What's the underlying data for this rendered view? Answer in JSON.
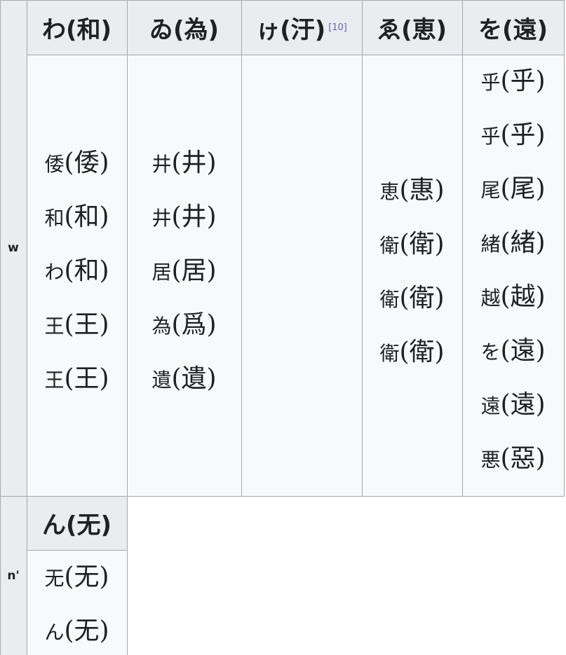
{
  "rows": [
    {
      "label": "w",
      "columns": [
        {
          "header": "わ(和)",
          "ref": "",
          "variants": [
            {
              "glyph": "倭",
              "text": "(倭)"
            },
            {
              "glyph": "和",
              "text": "(和)"
            },
            {
              "glyph": "わ",
              "text": "(和)"
            },
            {
              "glyph": "王",
              "text": "(王)"
            },
            {
              "glyph": "王",
              "text": "(王)"
            }
          ]
        },
        {
          "header": "ゐ(為)",
          "ref": "",
          "variants": [
            {
              "glyph": "井",
              "text": "(井)"
            },
            {
              "glyph": "井",
              "text": "(井)"
            },
            {
              "glyph": "居",
              "text": "(居)"
            },
            {
              "glyph": "為",
              "text": "(爲)"
            },
            {
              "glyph": "遺",
              "text": "(遺)"
            }
          ]
        },
        {
          "header": "ゖ(汙)",
          "ref": "[10]",
          "variants": []
        },
        {
          "header": "ゑ(恵)",
          "ref": "",
          "variants": [
            {
              "glyph": "恵",
              "text": "(惠)"
            },
            {
              "glyph": "衛",
              "text": "(衛)"
            },
            {
              "glyph": "衛",
              "text": "(衛)"
            },
            {
              "glyph": "衛",
              "text": "(衛)"
            }
          ]
        },
        {
          "header": "を(遠)",
          "ref": "",
          "variants": [
            {
              "glyph": "乎",
              "text": "(乎)"
            },
            {
              "glyph": "乎",
              "text": "(乎)"
            },
            {
              "glyph": "尾",
              "text": "(尾)"
            },
            {
              "glyph": "緒",
              "text": "(緒)"
            },
            {
              "glyph": "越",
              "text": "(越)"
            },
            {
              "glyph": "を",
              "text": "(遠)"
            },
            {
              "glyph": "遠",
              "text": "(遠)"
            },
            {
              "glyph": "悪",
              "text": "(惡)"
            }
          ]
        }
      ]
    },
    {
      "label": "n'",
      "columns": [
        {
          "header": "ん(无)",
          "ref": "",
          "variants": [
            {
              "glyph": "无",
              "text": "(无)"
            },
            {
              "glyph": "ん",
              "text": "(无)"
            }
          ]
        }
      ]
    }
  ],
  "colors": {
    "header_bg": "#eaecf0",
    "cell_bg": "#f8f9fa",
    "border": "#a2a9b1",
    "ref_link": "#6a60b0"
  }
}
